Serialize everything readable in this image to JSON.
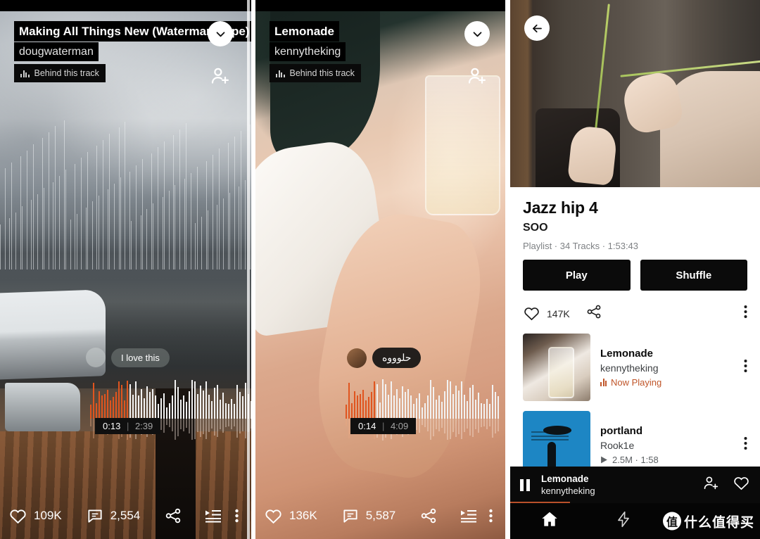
{
  "panel1": {
    "track_title": "Making All Things New (Waterman/Espe) - Recorde…",
    "artist": "dougwaterman",
    "behind_label": "Behind this track",
    "comment": "I love this",
    "time_current": "0:13",
    "time_separator": "|",
    "time_total": "2:39",
    "actions": {
      "like_count": "109K",
      "comment_count": "2,554",
      "share_label": "share-icon",
      "queue_label": "queue-icon",
      "more_label": "more-icon"
    }
  },
  "panel2": {
    "track_title": "Lemonade",
    "artist": "kennytheking",
    "behind_label": "Behind this track",
    "comment": "حلوووه",
    "time_current": "0:14",
    "time_separator": "|",
    "time_total": "4:09",
    "actions": {
      "like_count": "136K",
      "comment_count": "5,587",
      "share_label": "share-icon",
      "queue_label": "queue-icon",
      "more_label": "more-icon"
    }
  },
  "panel3": {
    "playlist_title": "Jazz hip 4",
    "playlist_owner": "SOO",
    "playlist_meta": "Playlist · 34 Tracks · 1:53:43",
    "play_label": "Play",
    "shuffle_label": "Shuffle",
    "like_count": "147K",
    "tracks": [
      {
        "name": "Lemonade",
        "artist": "kennytheking",
        "status": "Now Playing",
        "status_type": "now-playing"
      },
      {
        "name": "portland",
        "artist": "Rook1e",
        "status": "2.5M · 1:58",
        "status_type": "plays"
      }
    ],
    "mini_player": {
      "title": "Lemonade",
      "artist": "kennytheking"
    },
    "nav": {
      "home": "home-icon",
      "bolt": "bolt-icon"
    },
    "watermark": {
      "badge": "值",
      "text": "什么值得买"
    }
  },
  "colors": {
    "accent_orange": "#d9531e",
    "now_playing": "#c0562a",
    "artwork_blue": "#1d86c4",
    "overlay_black": "#000000"
  }
}
